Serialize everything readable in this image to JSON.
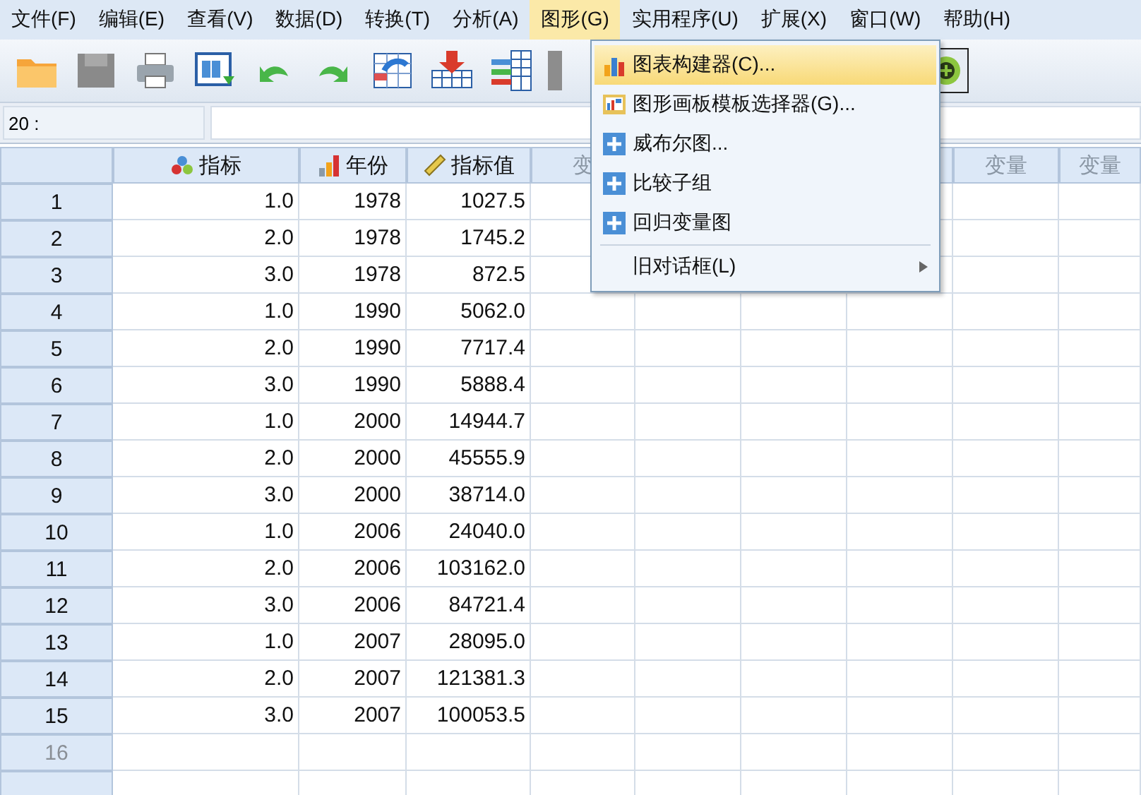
{
  "menu_bar": [
    {
      "label": "文件(F)",
      "selected": false
    },
    {
      "label": "编辑(E)",
      "selected": false
    },
    {
      "label": "查看(V)",
      "selected": false
    },
    {
      "label": "数据(D)",
      "selected": false
    },
    {
      "label": "转换(T)",
      "selected": false
    },
    {
      "label": "分析(A)",
      "selected": false
    },
    {
      "label": "图形(G)",
      "selected": true
    },
    {
      "label": "实用程序(U)",
      "selected": false
    },
    {
      "label": "扩展(X)",
      "selected": false
    },
    {
      "label": "窗口(W)",
      "selected": false
    },
    {
      "label": "帮助(H)",
      "selected": false
    }
  ],
  "cell_reference": "20 :",
  "grid": {
    "columns": [
      {
        "label": "指标",
        "kind": "nominal"
      },
      {
        "label": "年份",
        "kind": "ordinal"
      },
      {
        "label": "指标值",
        "kind": "scale"
      },
      {
        "label": "变",
        "kind": "empty"
      },
      {
        "kind": "empty"
      },
      {
        "kind": "empty"
      },
      {
        "kind": "empty"
      },
      {
        "label": "变量",
        "kind": "empty"
      },
      {
        "label": "变量",
        "kind": "empty"
      }
    ],
    "rows": [
      {
        "number": "1",
        "cells": [
          "1.0",
          "1978",
          "1027.5"
        ],
        "empty": false
      },
      {
        "number": "2",
        "cells": [
          "2.0",
          "1978",
          "1745.2"
        ],
        "empty": false
      },
      {
        "number": "3",
        "cells": [
          "3.0",
          "1978",
          "872.5"
        ],
        "empty": false
      },
      {
        "number": "4",
        "cells": [
          "1.0",
          "1990",
          "5062.0"
        ],
        "empty": false
      },
      {
        "number": "5",
        "cells": [
          "2.0",
          "1990",
          "7717.4"
        ],
        "empty": false
      },
      {
        "number": "6",
        "cells": [
          "3.0",
          "1990",
          "5888.4"
        ],
        "empty": false
      },
      {
        "number": "7",
        "cells": [
          "1.0",
          "2000",
          "14944.7"
        ],
        "empty": false
      },
      {
        "number": "8",
        "cells": [
          "2.0",
          "2000",
          "45555.9"
        ],
        "empty": false
      },
      {
        "number": "9",
        "cells": [
          "3.0",
          "2000",
          "38714.0"
        ],
        "empty": false
      },
      {
        "number": "10",
        "cells": [
          "1.0",
          "2006",
          "24040.0"
        ],
        "empty": false
      },
      {
        "number": "11",
        "cells": [
          "2.0",
          "2006",
          "103162.0"
        ],
        "empty": false
      },
      {
        "number": "12",
        "cells": [
          "3.0",
          "2006",
          "84721.4"
        ],
        "empty": false
      },
      {
        "number": "13",
        "cells": [
          "1.0",
          "2007",
          "28095.0"
        ],
        "empty": false
      },
      {
        "number": "14",
        "cells": [
          "2.0",
          "2007",
          "121381.3"
        ],
        "empty": false
      },
      {
        "number": "15",
        "cells": [
          "3.0",
          "2007",
          "100053.5"
        ],
        "empty": false
      },
      {
        "number": "16",
        "cells": [],
        "empty": true
      },
      {
        "cells": []
      }
    ]
  },
  "graphs_menu": {
    "items": [
      {
        "label": "图表构建器(C)...",
        "kind": "chart",
        "selected": true
      },
      {
        "label": "图形画板模板选择器(G)...",
        "kind": "template",
        "selected": false
      },
      {
        "label": "威布尔图...",
        "kind": "plus",
        "selected": false
      },
      {
        "label": "比较子组",
        "kind": "plus",
        "selected": false
      },
      {
        "label": "回归变量图",
        "kind": "plus",
        "selected": false
      },
      {
        "label": "旧对话框(L)",
        "kind": "submenu",
        "selected": false
      }
    ]
  }
}
